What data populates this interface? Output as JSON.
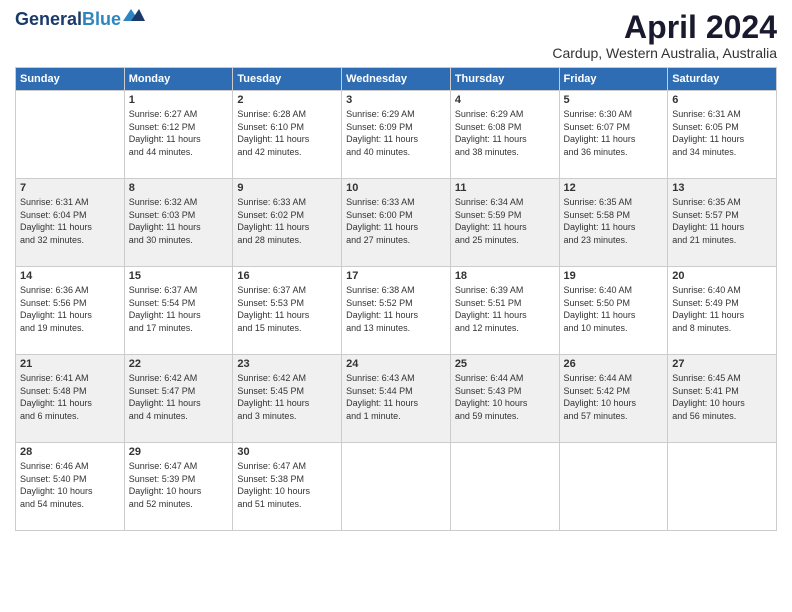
{
  "logo": {
    "line1": "General",
    "line2": "Blue"
  },
  "title": "April 2024",
  "location": "Cardup, Western Australia, Australia",
  "weekdays": [
    "Sunday",
    "Monday",
    "Tuesday",
    "Wednesday",
    "Thursday",
    "Friday",
    "Saturday"
  ],
  "weeks": [
    [
      {
        "num": "",
        "info": ""
      },
      {
        "num": "1",
        "info": "Sunrise: 6:27 AM\nSunset: 6:12 PM\nDaylight: 11 hours\nand 44 minutes."
      },
      {
        "num": "2",
        "info": "Sunrise: 6:28 AM\nSunset: 6:10 PM\nDaylight: 11 hours\nand 42 minutes."
      },
      {
        "num": "3",
        "info": "Sunrise: 6:29 AM\nSunset: 6:09 PM\nDaylight: 11 hours\nand 40 minutes."
      },
      {
        "num": "4",
        "info": "Sunrise: 6:29 AM\nSunset: 6:08 PM\nDaylight: 11 hours\nand 38 minutes."
      },
      {
        "num": "5",
        "info": "Sunrise: 6:30 AM\nSunset: 6:07 PM\nDaylight: 11 hours\nand 36 minutes."
      },
      {
        "num": "6",
        "info": "Sunrise: 6:31 AM\nSunset: 6:05 PM\nDaylight: 11 hours\nand 34 minutes."
      }
    ],
    [
      {
        "num": "7",
        "info": "Sunrise: 6:31 AM\nSunset: 6:04 PM\nDaylight: 11 hours\nand 32 minutes."
      },
      {
        "num": "8",
        "info": "Sunrise: 6:32 AM\nSunset: 6:03 PM\nDaylight: 11 hours\nand 30 minutes."
      },
      {
        "num": "9",
        "info": "Sunrise: 6:33 AM\nSunset: 6:02 PM\nDaylight: 11 hours\nand 28 minutes."
      },
      {
        "num": "10",
        "info": "Sunrise: 6:33 AM\nSunset: 6:00 PM\nDaylight: 11 hours\nand 27 minutes."
      },
      {
        "num": "11",
        "info": "Sunrise: 6:34 AM\nSunset: 5:59 PM\nDaylight: 11 hours\nand 25 minutes."
      },
      {
        "num": "12",
        "info": "Sunrise: 6:35 AM\nSunset: 5:58 PM\nDaylight: 11 hours\nand 23 minutes."
      },
      {
        "num": "13",
        "info": "Sunrise: 6:35 AM\nSunset: 5:57 PM\nDaylight: 11 hours\nand 21 minutes."
      }
    ],
    [
      {
        "num": "14",
        "info": "Sunrise: 6:36 AM\nSunset: 5:56 PM\nDaylight: 11 hours\nand 19 minutes."
      },
      {
        "num": "15",
        "info": "Sunrise: 6:37 AM\nSunset: 5:54 PM\nDaylight: 11 hours\nand 17 minutes."
      },
      {
        "num": "16",
        "info": "Sunrise: 6:37 AM\nSunset: 5:53 PM\nDaylight: 11 hours\nand 15 minutes."
      },
      {
        "num": "17",
        "info": "Sunrise: 6:38 AM\nSunset: 5:52 PM\nDaylight: 11 hours\nand 13 minutes."
      },
      {
        "num": "18",
        "info": "Sunrise: 6:39 AM\nSunset: 5:51 PM\nDaylight: 11 hours\nand 12 minutes."
      },
      {
        "num": "19",
        "info": "Sunrise: 6:40 AM\nSunset: 5:50 PM\nDaylight: 11 hours\nand 10 minutes."
      },
      {
        "num": "20",
        "info": "Sunrise: 6:40 AM\nSunset: 5:49 PM\nDaylight: 11 hours\nand 8 minutes."
      }
    ],
    [
      {
        "num": "21",
        "info": "Sunrise: 6:41 AM\nSunset: 5:48 PM\nDaylight: 11 hours\nand 6 minutes."
      },
      {
        "num": "22",
        "info": "Sunrise: 6:42 AM\nSunset: 5:47 PM\nDaylight: 11 hours\nand 4 minutes."
      },
      {
        "num": "23",
        "info": "Sunrise: 6:42 AM\nSunset: 5:45 PM\nDaylight: 11 hours\nand 3 minutes."
      },
      {
        "num": "24",
        "info": "Sunrise: 6:43 AM\nSunset: 5:44 PM\nDaylight: 11 hours\nand 1 minute."
      },
      {
        "num": "25",
        "info": "Sunrise: 6:44 AM\nSunset: 5:43 PM\nDaylight: 10 hours\nand 59 minutes."
      },
      {
        "num": "26",
        "info": "Sunrise: 6:44 AM\nSunset: 5:42 PM\nDaylight: 10 hours\nand 57 minutes."
      },
      {
        "num": "27",
        "info": "Sunrise: 6:45 AM\nSunset: 5:41 PM\nDaylight: 10 hours\nand 56 minutes."
      }
    ],
    [
      {
        "num": "28",
        "info": "Sunrise: 6:46 AM\nSunset: 5:40 PM\nDaylight: 10 hours\nand 54 minutes."
      },
      {
        "num": "29",
        "info": "Sunrise: 6:47 AM\nSunset: 5:39 PM\nDaylight: 10 hours\nand 52 minutes."
      },
      {
        "num": "30",
        "info": "Sunrise: 6:47 AM\nSunset: 5:38 PM\nDaylight: 10 hours\nand 51 minutes."
      },
      {
        "num": "",
        "info": ""
      },
      {
        "num": "",
        "info": ""
      },
      {
        "num": "",
        "info": ""
      },
      {
        "num": "",
        "info": ""
      }
    ]
  ]
}
